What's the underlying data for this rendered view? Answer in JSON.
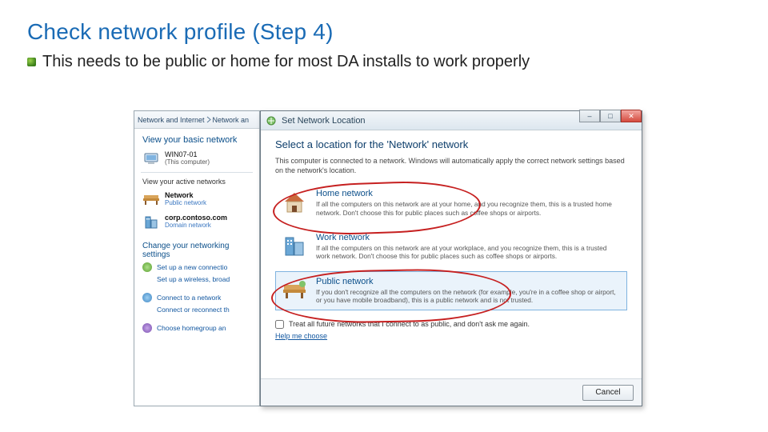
{
  "slide": {
    "title": "Check network profile (Step 4)",
    "bullet": "This needs to be public or home for most DA installs to work properly"
  },
  "bgwin": {
    "breadcrumb_a": "Network and Internet",
    "breadcrumb_b": "Network an",
    "section_view": "View your basic network",
    "computer_name": "WIN07-01",
    "computer_sub": "(This computer)",
    "active_header": "View your active networks",
    "net1_label": "Network",
    "net1_sub": "Public network",
    "net2_label": "corp.contoso.com",
    "net2_sub": "Domain network",
    "change_header": "Change your networking settings",
    "task1": "Set up a new connectio",
    "task2": "Set up a wireless, broad",
    "task3": "Connect to a network",
    "task4": "Connect or reconnect th",
    "task5": "Choose homegroup an"
  },
  "dlg": {
    "chrome": {
      "min": "–",
      "max": "□",
      "close": "✕"
    },
    "title": "Set Network Location",
    "heading": "Select a location for the 'Network' network",
    "intro": "This computer is connected to a network. Windows will automatically apply the correct network settings based on the network's location.",
    "home": {
      "title": "Home network",
      "desc": "If all the computers on this network are at your home, and you recognize them, this is a trusted home network. Don't choose this for public places such as coffee shops or airports."
    },
    "work": {
      "title": "Work network",
      "desc": "If all the computers on this network are at your workplace, and you recognize them, this is a trusted work network. Don't choose this for public places such as coffee shops or airports."
    },
    "public": {
      "title": "Public network",
      "desc": "If you don't recognize all the computers on the network (for example, you're in a coffee shop or airport, or you have mobile broadband), this is a public network and is not trusted."
    },
    "checkbox": "Treat all future networks that I connect to as public, and don't ask me again.",
    "help": "Help me choose",
    "cancel": "Cancel"
  }
}
